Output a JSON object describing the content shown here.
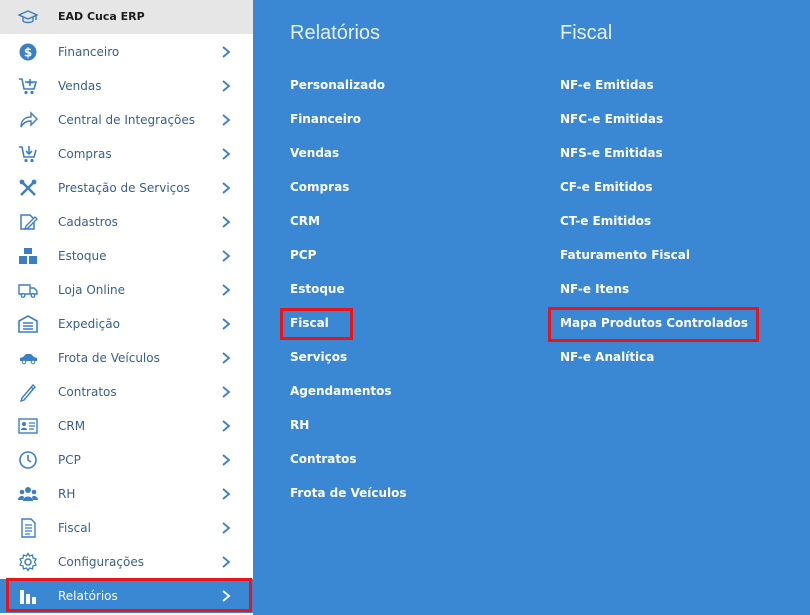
{
  "sidebar": {
    "header": {
      "title": "EAD Cuca ERP",
      "icon": "graduation-cap-icon"
    },
    "items": [
      {
        "label": "Financeiro",
        "icon": "dollar-circle-icon"
      },
      {
        "label": "Vendas",
        "icon": "cart-add-icon"
      },
      {
        "label": "Central de Integrações",
        "icon": "share-arrow-icon"
      },
      {
        "label": "Compras",
        "icon": "cart-download-icon"
      },
      {
        "label": "Prestação de Serviços",
        "icon": "tools-icon"
      },
      {
        "label": "Cadastros",
        "icon": "edit-icon"
      },
      {
        "label": "Estoque",
        "icon": "boxes-icon"
      },
      {
        "label": "Loja Online",
        "icon": "truck-icon"
      },
      {
        "label": "Expedição",
        "icon": "warehouse-icon"
      },
      {
        "label": "Frota de Veículos",
        "icon": "car-icon"
      },
      {
        "label": "Contratos",
        "icon": "pen-icon"
      },
      {
        "label": "CRM",
        "icon": "id-card-icon"
      },
      {
        "label": "PCP",
        "icon": "clock-icon"
      },
      {
        "label": "RH",
        "icon": "users-icon"
      },
      {
        "label": "Fiscal",
        "icon": "document-icon"
      },
      {
        "label": "Configurações",
        "icon": "gear-icon"
      },
      {
        "label": "Relatórios",
        "icon": "bar-chart-icon",
        "active": true
      }
    ]
  },
  "panel": {
    "relatorios": {
      "heading": "Relatórios",
      "links": [
        "Personalizado",
        "Financeiro",
        "Vendas",
        "Compras",
        "CRM",
        "PCP",
        "Estoque",
        "Fiscal",
        "Serviços",
        "Agendamentos",
        "RH",
        "Contratos",
        "Frota de Veículos"
      ],
      "highlighted": "Fiscal"
    },
    "fiscal": {
      "heading": "Fiscal",
      "links": [
        "NF-e Emitidas",
        "NFC-e Emitidas",
        "NFS-e Emitidas",
        "CF-e Emitidos",
        "CT-e Emitidos",
        "Faturamento Fiscal",
        "NF-e Itens",
        "Mapa Produtos Controlados",
        "NF-e Analítica"
      ],
      "highlighted": "Mapa Produtos Controlados"
    }
  },
  "colors": {
    "panel_bg": "#3a87d4",
    "sidebar_bg": "#ffffff",
    "header_bg": "#e6e6e6",
    "icon_blue": "#3a7fc4",
    "label_text": "#3a5f86",
    "highlight_border": "#e8141c"
  }
}
